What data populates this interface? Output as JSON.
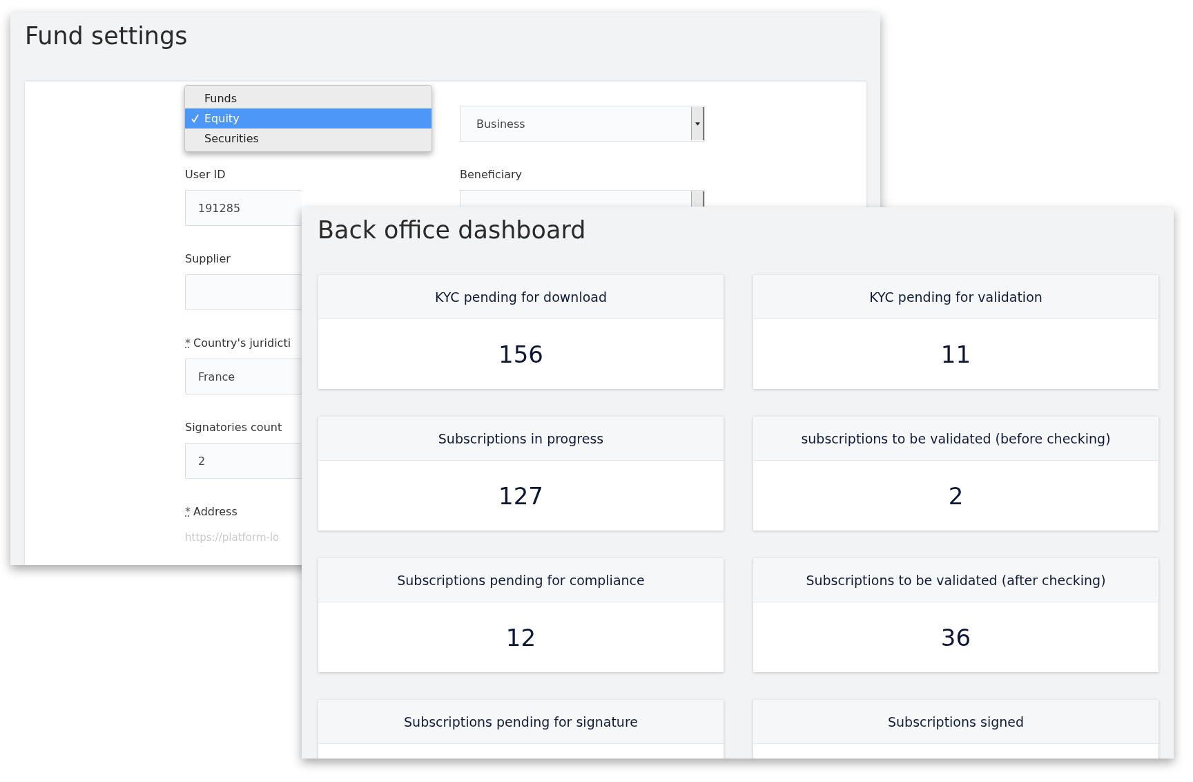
{
  "fund_settings": {
    "title": "Fund settings",
    "type_menu": {
      "options": [
        {
          "label": "Funds",
          "selected": false
        },
        {
          "label": "Equity",
          "selected": true
        },
        {
          "label": "Securities",
          "selected": false
        }
      ]
    },
    "left_fields": [
      {
        "label": "User ID",
        "kind": "input",
        "value": "191285"
      },
      {
        "label": "Supplier",
        "kind": "input"
      },
      {
        "label": "Country's juridicti",
        "required_mark": "*",
        "kind": "input",
        "value": "France"
      },
      {
        "label": "Signatories count",
        "kind": "input",
        "value": "2"
      },
      {
        "label": "Address",
        "required_mark": "*",
        "kind": "plain",
        "placeholder": "https://platform-lo"
      }
    ],
    "right_fields": [
      {
        "kind": "select",
        "value": "Business"
      },
      {
        "label": "Beneficiary",
        "kind": "clipped"
      }
    ]
  },
  "dashboard": {
    "title": "Back office dashboard",
    "cards": [
      {
        "title": "KYC pending for download",
        "value": "156"
      },
      {
        "title": "KYC pending for validation",
        "value": "11"
      },
      {
        "title": "Subscriptions in progress",
        "value": "127"
      },
      {
        "title": "subscriptions to be validated (before checking)",
        "value": "2"
      },
      {
        "title": "Subscriptions pending for compliance",
        "value": "12"
      },
      {
        "title": "Subscriptions to be validated (after checking)",
        "value": "36"
      },
      {
        "title": "Subscriptions pending for signature"
      },
      {
        "title": "Subscriptions signed"
      }
    ]
  }
}
